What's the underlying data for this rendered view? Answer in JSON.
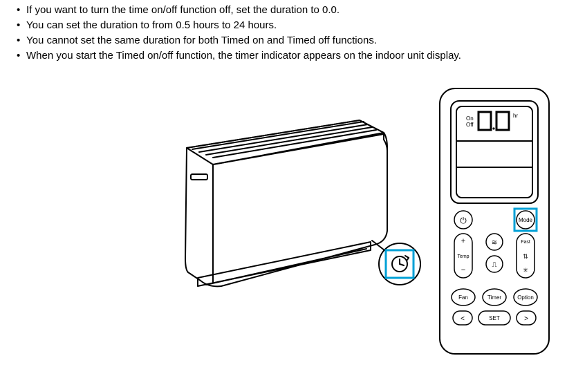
{
  "bullets": [
    "If you want to turn the time on/off function off, set the duration to 0.0.",
    "You can set the duration to from 0.5 hours to 24 hours.",
    "You cannot set the same duration for both Timed on and Timed off functions.",
    "When you start the Timed on/off function, the timer indicator appears on the indoor unit display."
  ],
  "remote": {
    "display_on": "On",
    "display_off": "Off",
    "display_digits": "0.0",
    "display_hr": "hr",
    "power": "⏻",
    "mode": "Mode",
    "plus": "+",
    "temp": "Temp",
    "minus": "−",
    "icon2": "≋",
    "icon3": "⎍",
    "fast": "Fast",
    "icon5": "⇅",
    "icon6": "✳",
    "fan": "Fan",
    "timer": "Timer",
    "option": "Option",
    "left": "<",
    "set": "SET",
    "right": ">"
  }
}
